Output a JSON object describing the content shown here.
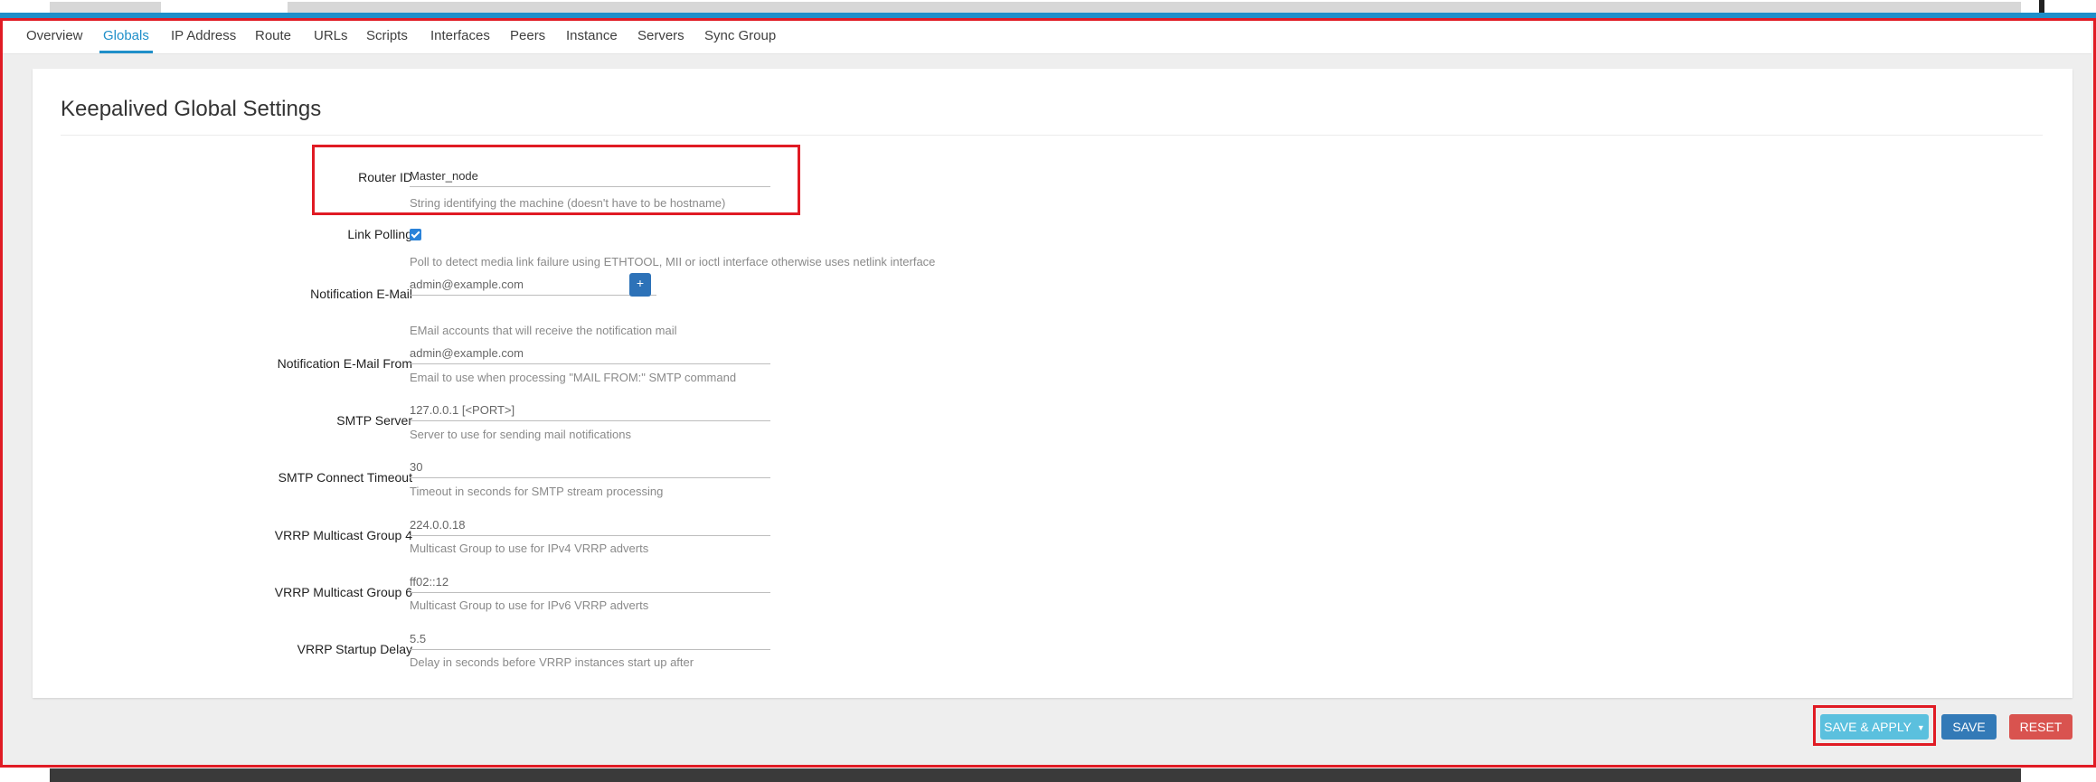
{
  "tabs": [
    {
      "label": "Overview"
    },
    {
      "label": "Globals"
    },
    {
      "label": "IP Address"
    },
    {
      "label": "Route"
    },
    {
      "label": "URLs"
    },
    {
      "label": "Scripts"
    },
    {
      "label": "Interfaces"
    },
    {
      "label": "Peers"
    },
    {
      "label": "Instance"
    },
    {
      "label": "Servers"
    },
    {
      "label": "Sync Group"
    }
  ],
  "active_tab": "Globals",
  "section": {
    "title": "Keepalived Global Settings"
  },
  "fields": {
    "router_id": {
      "label": "Router ID",
      "value": "Master_node",
      "hint": "String identifying the machine (doesn't have to be hostname)"
    },
    "link_polling": {
      "label": "Link Polling",
      "checked": true,
      "hint": "Poll to detect media link failure using ETHTOOL, MII or ioctl interface otherwise uses netlink interface"
    },
    "notification_email": {
      "label": "Notification E-Mail",
      "placeholder": "admin@example.com",
      "add_label": "+",
      "hint": "EMail accounts that will receive the notification mail"
    },
    "notification_email_from": {
      "label": "Notification E-Mail From",
      "placeholder": "admin@example.com",
      "hint": "Email to use when processing \"MAIL FROM:\" SMTP command"
    },
    "smtp_server": {
      "label": "SMTP Server",
      "placeholder": "127.0.0.1 [<PORT>]",
      "hint": "Server to use for sending mail notifications"
    },
    "smtp_connect_timeout": {
      "label": "SMTP Connect Timeout",
      "placeholder": "30",
      "hint": "Timeout in seconds for SMTP stream processing"
    },
    "vrrp_mcast_group4": {
      "label": "VRRP Multicast Group 4",
      "placeholder": "224.0.0.18",
      "hint": "Multicast Group to use for IPv4 VRRP adverts"
    },
    "vrrp_mcast_group6": {
      "label": "VRRP Multicast Group 6",
      "placeholder": "ff02::12",
      "hint": "Multicast Group to use for IPv6 VRRP adverts"
    },
    "vrrp_startup_delay": {
      "label": "VRRP Startup Delay",
      "placeholder": "5.5",
      "hint": "Delay in seconds before VRRP instances start up after"
    }
  },
  "actions": {
    "save_apply": "SAVE & APPLY",
    "save": "SAVE",
    "reset": "RESET"
  },
  "colors": {
    "accent": "#1f8fc9",
    "highlight": "#e01b24",
    "save_apply": "#5bc0de",
    "save": "#337ab7",
    "reset": "#d9534f"
  }
}
